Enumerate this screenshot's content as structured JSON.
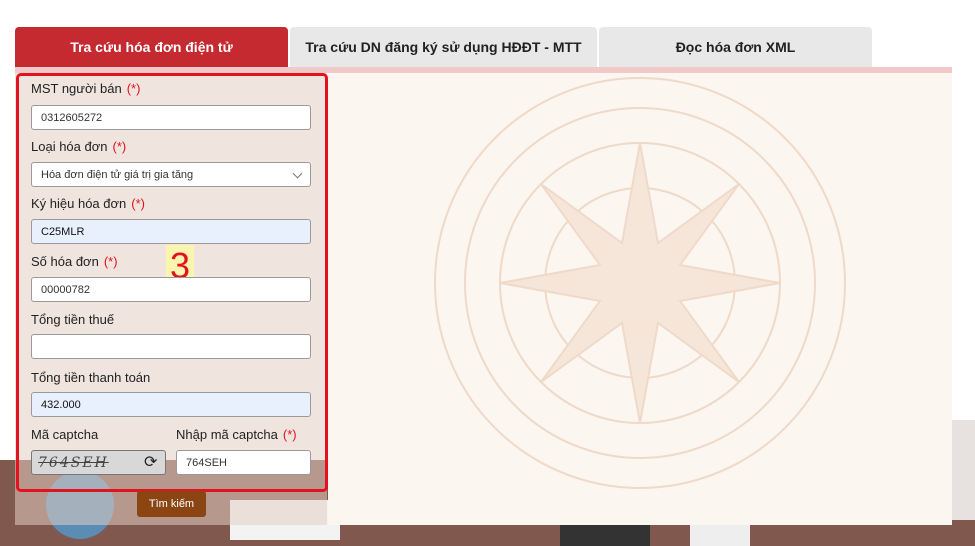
{
  "tabs": [
    {
      "label": "Tra cứu hóa đơn điện tử",
      "active": true
    },
    {
      "label": "Tra cứu DN đăng ký sử dụng HĐĐT - MTT",
      "active": false
    },
    {
      "label": "Đọc hóa đơn XML",
      "active": false
    }
  ],
  "form": {
    "required_mark": "(*)",
    "seller_tax_label": "MST người bán",
    "seller_tax_value": "0312605272",
    "invoice_type_label": "Loại hóa đơn",
    "invoice_type_value": "Hóa đơn điện tử giá trị gia tăng",
    "invoice_symbol_label": "Ký hiệu hóa đơn",
    "invoice_symbol_value": "C25MLR",
    "invoice_number_label": "Số hóa đơn",
    "invoice_number_value": "00000782",
    "total_tax_label": "Tổng tiền thuế",
    "total_tax_value": "",
    "total_payment_label": "Tổng tiền thanh toán",
    "total_payment_value": "432.000",
    "captcha_label": "Mã captcha",
    "captcha_image_text": "764SEH",
    "captcha_input_label": "Nhập mã captcha",
    "captcha_input_value": "764SEH",
    "search_button": "Tìm kiếm"
  },
  "annotation": "3",
  "colors": {
    "accent": "#c42a2f",
    "highlight_border": "#e3121f",
    "button": "#8b4513"
  },
  "icons": [
    "chevron-down-icon",
    "refresh-icon"
  ]
}
